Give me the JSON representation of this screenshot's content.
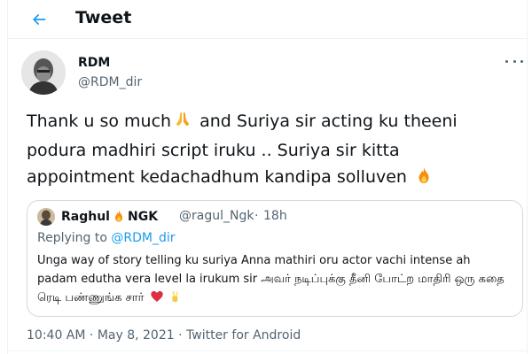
{
  "header": {
    "title": "Tweet"
  },
  "tweet": {
    "author_name": "RDM",
    "author_handle": "@RDM_dir",
    "text_part1": "Thank u so much",
    "text_part2": " and Suriya sir acting ku theeni podura madhiri script iruku .. Suriya sir kitta appointment kedachadhum kandipa solluven ",
    "emoji_names": [
      "folded-hands",
      "fire"
    ]
  },
  "quoted_tweet": {
    "author_name_part1": "Raghul",
    "author_name_part2": "NGK",
    "author_handle": "@ragul_Ngk",
    "separator": "·",
    "time": "18h",
    "replying_to_prefix": "Replying to ",
    "replying_to_handle": "@RDM_dir",
    "text": "Unga way of story telling ku suriya Anna mathiri oru actor vachi intense ah padam edutha vera level la irukum sir அவர் நடிப்புக்கு தீனி போட்ற மாதிரி ஒரு கதை ரெடி பண்ணுங்க சார் ",
    "emoji_names": [
      "fire",
      "red-heart",
      "victory-hand"
    ]
  },
  "meta": {
    "time": "10:40 AM",
    "sep1": " · ",
    "date": "May 8, 2021",
    "sep2": " · ",
    "source": "Twitter for Android"
  },
  "colors": {
    "accent": "#1d9bf0",
    "text": "#0f1419",
    "secondary": "#536471",
    "border": "#cfd9de"
  }
}
